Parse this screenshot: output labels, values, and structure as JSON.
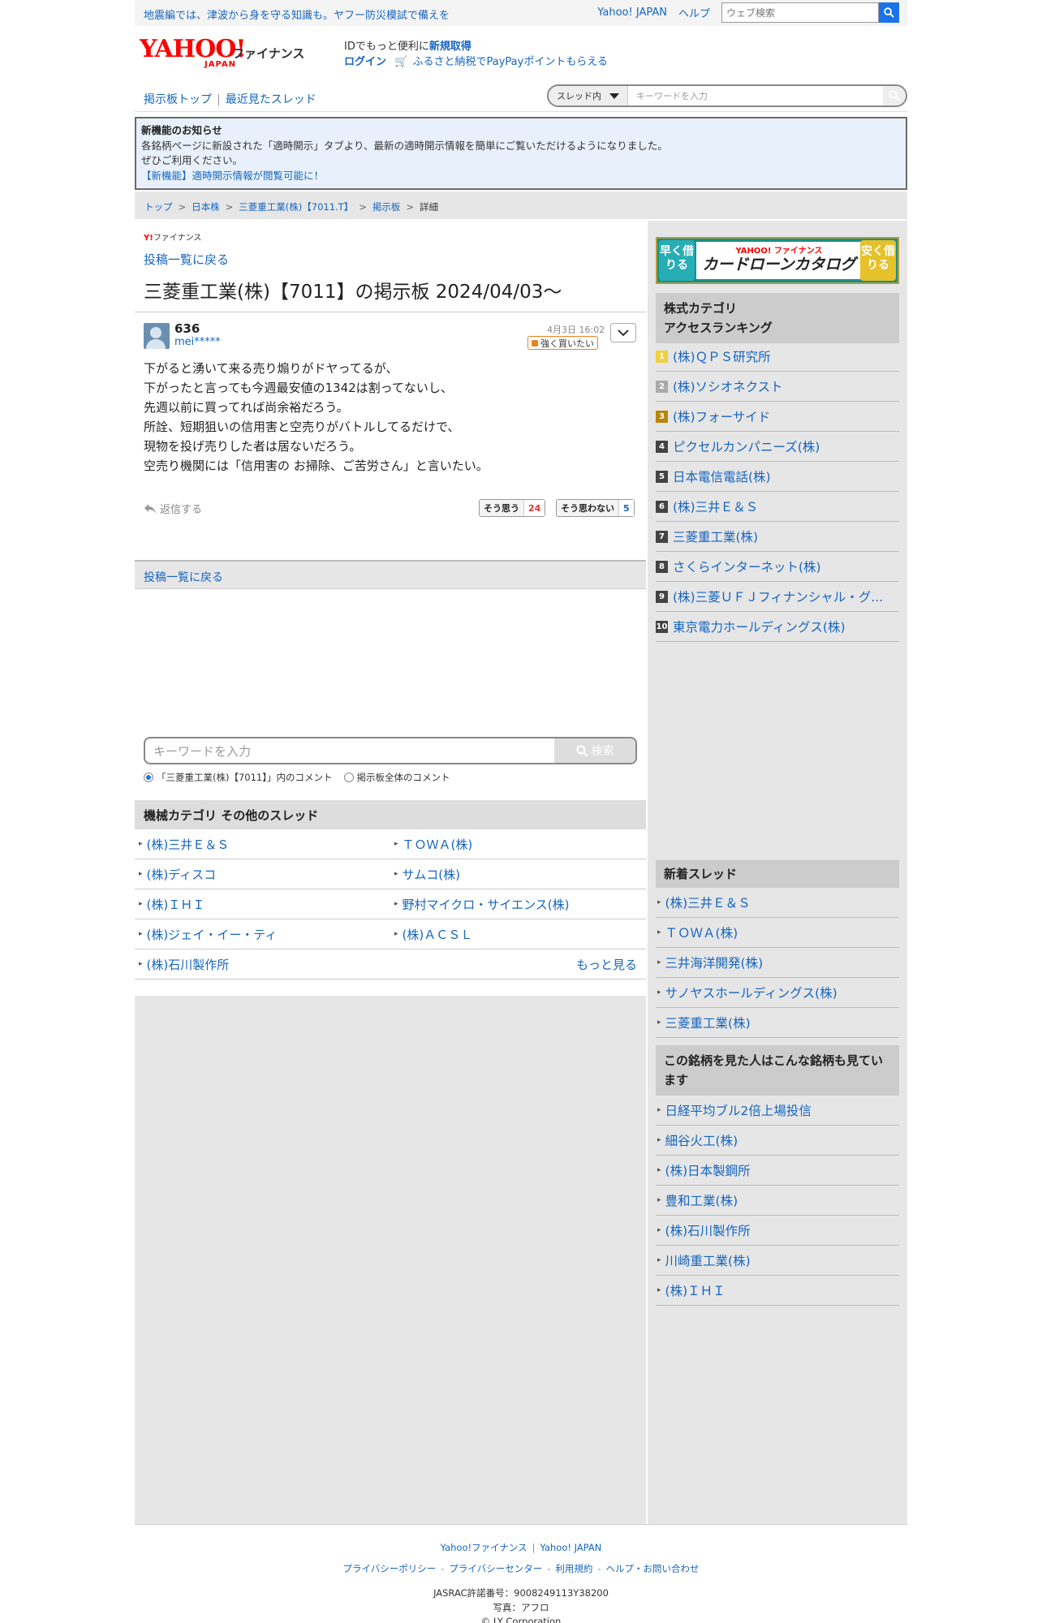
{
  "emergency": {
    "text": "地震編では、津波から身を守る知識も。ヤフー防災模試で備えを"
  },
  "topnav": {
    "yahoo_japan": "Yahoo! JAPAN",
    "help": "ヘルプ",
    "web_search_placeholder": "ウェブ検索"
  },
  "header": {
    "logo_text": "YAHOO!",
    "logo_sub": "JAPAN",
    "service_name": "ファイナンス",
    "promo_line1_prefix": "IDでもっと便利に",
    "promo_line1_link": "新規取得",
    "promo_login": "ログイン",
    "promo_line2": "ふるさと納税でPayPayポイントもらえる"
  },
  "board_nav": {
    "top": "掲示板トップ",
    "recent": "最近見たスレッド",
    "scope": "スレッド内",
    "search_placeholder": "キーワードを入力"
  },
  "notice": {
    "title": "新機能のお知らせ",
    "line1": "各銘柄ページに新設された「適時開示」タブより、最新の適時開示情報を簡単にご覧いただけるようになりました。",
    "line2": "ぜひご利用ください。",
    "link": "【新機能】適時開示情報が閲覧可能に！"
  },
  "breadcrumb": [
    "トップ",
    "日本株",
    "三菱重工業(株)【7011.T】",
    "掲示板",
    "詳細"
  ],
  "board": {
    "brand_small": "ファイナンス",
    "back_link": "投稿一覧に戻る",
    "title": "三菱重工業(株)【7011】の掲示板 2024/04/03〜"
  },
  "post": {
    "number": "636",
    "author": "mei*****",
    "date": "4月3日 16:02",
    "sentiment": "強く買いたい",
    "body": [
      "下がると湧いて来る売り煽りがドヤってるが、",
      "下がったと言っても今週最安値の1342は割ってないし、",
      "先週以前に買ってれば尚余裕だろう。",
      "所詮、短期狙いの信用害と空売りがバトルしてるだけで、",
      "現物を投げ売りした者は居ないだろう。",
      "空売り機関には「信用害の お掃除、ご苦労さん」と言いたい。"
    ],
    "reply": "返信する",
    "agree_label": "そう思う",
    "agree_count": "24",
    "disagree_label": "そう思わない",
    "disagree_count": "5"
  },
  "back_bar": "投稿一覧に戻る",
  "keyword_search": {
    "placeholder": "キーワードを入力",
    "button": "検索",
    "option_thread": "「三菱重工業(株)【7011】」内のコメント",
    "option_all": "掲示板全体のコメント"
  },
  "category": {
    "heading": "機械カテゴリ  その他のスレッド",
    "items": [
      "(株)三井Ｅ＆Ｓ",
      "ＴＯＷＡ(株)",
      "(株)ディスコ",
      "サムコ(株)",
      "(株)ＩＨＩ",
      "野村マイクロ・サイエンス(株)",
      "(株)ジェイ・イー・ティ",
      "(株)ＡＣＳＬ",
      "(株)石川製作所"
    ],
    "more": "もっと見る"
  },
  "sidebar": {
    "banner": {
      "left": "早く借りる",
      "brand": "YAHOO! ファイナンス",
      "main": "カードローンカタログ",
      "right": "安く借りる"
    },
    "ranking_heading_1": "株式カテゴリ",
    "ranking_heading_2": "アクセスランキング",
    "ranking": [
      {
        "rank": "1",
        "name": "(株)ＱＰＳ研究所",
        "color": "#f0d040"
      },
      {
        "rank": "2",
        "name": "(株)ソシオネクスト",
        "color": "#aaaaaa"
      },
      {
        "rank": "3",
        "name": "(株)フォーサイド",
        "color": "#b8860b"
      },
      {
        "rank": "4",
        "name": "ピクセルカンパニーズ(株)",
        "color": "#444444"
      },
      {
        "rank": "5",
        "name": "日本電信電話(株)",
        "color": "#444444"
      },
      {
        "rank": "6",
        "name": "(株)三井Ｅ＆Ｓ",
        "color": "#444444"
      },
      {
        "rank": "7",
        "name": "三菱重工業(株)",
        "color": "#444444"
      },
      {
        "rank": "8",
        "name": "さくらインターネット(株)",
        "color": "#444444"
      },
      {
        "rank": "9",
        "name": "(株)三菱ＵＦＪフィナンシャル・グ...",
        "color": "#444444"
      },
      {
        "rank": "10",
        "name": "東京電力ホールディングス(株)",
        "color": "#444444"
      }
    ],
    "new_heading": "新着スレッド",
    "new_threads": [
      "(株)三井Ｅ＆Ｓ",
      "ＴＯＷＡ(株)",
      "三井海洋開発(株)",
      "サノヤスホールディングス(株)",
      "三菱重工業(株)"
    ],
    "also_heading": "この銘柄を見た人はこんな銘柄も見ています",
    "also": [
      "日経平均ブル2倍上場投信",
      "細谷火工(株)",
      "(株)日本製鋼所",
      "豊和工業(株)",
      "(株)石川製作所",
      "川崎重工業(株)",
      "(株)ＩＨＩ"
    ]
  },
  "footer": {
    "links1": [
      "Yahoo!ファイナンス",
      "Yahoo! JAPAN"
    ],
    "links2": [
      "プライバシーポリシー",
      "プライバシーセンター",
      "利用規約",
      "ヘルプ・お問い合わせ"
    ],
    "jasrac": "JASRAC許諾番号：9008249113Y38200",
    "photo": "写真：アフロ",
    "copyright": "© LY Corporation"
  }
}
